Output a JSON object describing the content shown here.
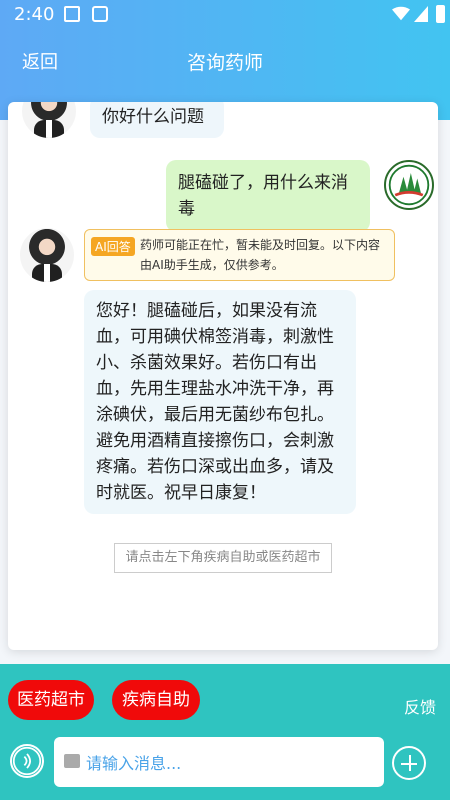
{
  "status": {
    "time": "2:40"
  },
  "header": {
    "back_label": "返回",
    "title": "咨询药师"
  },
  "chat": {
    "messages": [
      {
        "role": "pharmacist",
        "text": "你好什么问题"
      },
      {
        "role": "user",
        "text": "腿磕碰了，用什么来消毒"
      }
    ],
    "ai_note": {
      "tag": "AI回答",
      "text": "药师可能正在忙，暂未能及时回复。以下内容由AI助手生成，仅供参考。"
    },
    "ai_reply": "您好！腿磕碰后，如果没有流血，可用碘伏棉签消毒，刺激性小、杀菌效果好。若伤口有出血，先用生理盐水冲洗干净，再涂碘伏，最后用无菌纱布包扎。避免用酒精直接擦伤口，会刺激疼痛。若伤口深或出血多，请及时就医。祝早日康复！",
    "hint": "请点击左下角疾病自助或医药超市"
  },
  "bottom": {
    "buttons": [
      "医药超市",
      "疾病自助"
    ],
    "feedback": "反馈",
    "input_placeholder": "请输入消息..."
  },
  "icons": [
    "image-icon",
    "message-icon",
    "wifi-icon",
    "signal-icon",
    "battery-icon",
    "voice-icon",
    "plus-icon"
  ],
  "colors": {
    "accent": "#4fb7f3",
    "bottom_bar": "#2fc4c0",
    "pill": "#f00a0a"
  }
}
